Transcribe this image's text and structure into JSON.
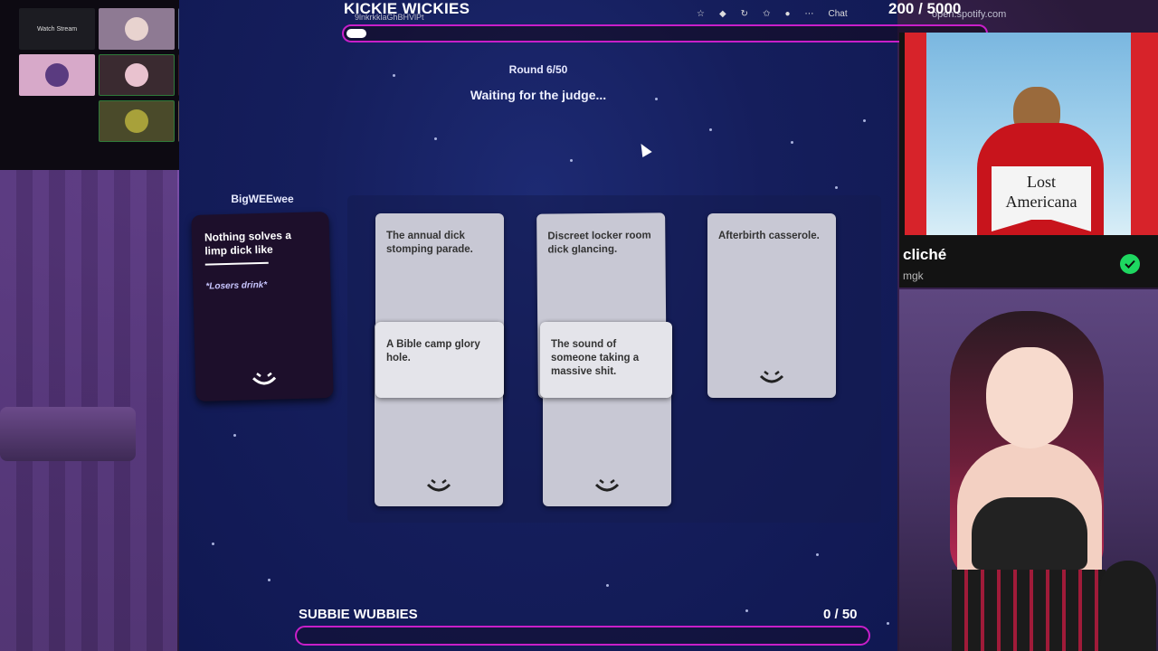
{
  "top_goal": {
    "title": "KICKIE WICKIES",
    "subtitle": "9lnkrkklaGhBHVlPt",
    "count": "200 / 5000",
    "progress": 0.04
  },
  "browser": {
    "chat_label": "Chat",
    "url_fragment": "open.spotify.com"
  },
  "cams": {
    "watch_label": "Watch Stream"
  },
  "game": {
    "round": "Round 6/50",
    "status": "Waiting for the judge...",
    "player_name": "BigWEEwee",
    "prompt": "Nothing solves a limp dick like",
    "rule": "*Losers drink*",
    "cards": [
      "The annual dick stomping parade.",
      "A Bible camp glory hole.",
      "Discreet locker room dick glancing.",
      "The sound of someone taking a massive shit.",
      "Afterbirth casserole."
    ]
  },
  "bottom_goal": {
    "title": "SUBBIE WUBBIES",
    "count": "0 / 50",
    "progress": 0.0
  },
  "music": {
    "album_text": "Lost Americana",
    "track": "cliché",
    "artist": "mgk",
    "accent": "#1ed760"
  },
  "colors": {
    "goal_bar": "#c81fc9",
    "game_bg": "#151e5c"
  }
}
